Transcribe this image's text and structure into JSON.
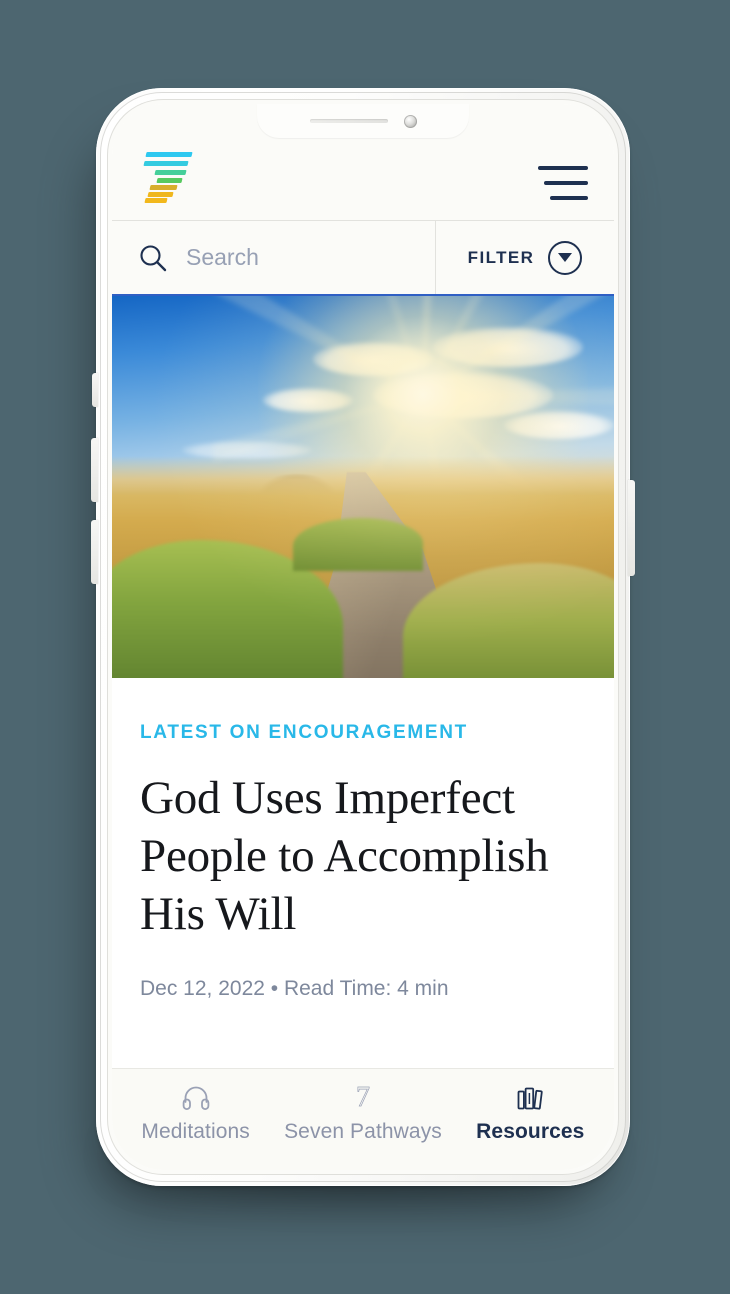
{
  "device": {
    "type": "white-smartphone-mockup",
    "background_color": "#4d6670"
  },
  "app": {
    "brand_logo": "seven-striped-logo",
    "logo_colors": [
      "#2ec8f0",
      "#2ec8f0",
      "#3fd0a8",
      "#4fc96a",
      "#e0b02a",
      "#f0b31e",
      "#f5b820"
    ],
    "accent_color": "#29b8e8",
    "nav_color": "#1e3050"
  },
  "header": {
    "menu_icon": "hamburger-menu-icon"
  },
  "search": {
    "icon": "search-icon",
    "placeholder": "Search",
    "value": "",
    "filter_label": "FILTER",
    "filter_icon": "chevron-down-circle-icon"
  },
  "hero": {
    "alt": "country dirt path through golden wheat fields at sunset with blue sky"
  },
  "article": {
    "eyebrow": "LATEST ON ENCOURAGEMENT",
    "headline": "God Uses Imperfect People to Accomplish His Will",
    "meta": "Dec 12, 2022 • Read Time: 4 min",
    "date": "Dec 12, 2022",
    "read_time": "Read Time: 4 min"
  },
  "bottom_nav": {
    "items": [
      {
        "label": "Meditations",
        "icon": "headphones-icon",
        "active": false
      },
      {
        "label": "Seven Pathways",
        "icon": "seven-numeral-icon",
        "active": false
      },
      {
        "label": "Resources",
        "icon": "books-icon",
        "active": true
      }
    ]
  }
}
